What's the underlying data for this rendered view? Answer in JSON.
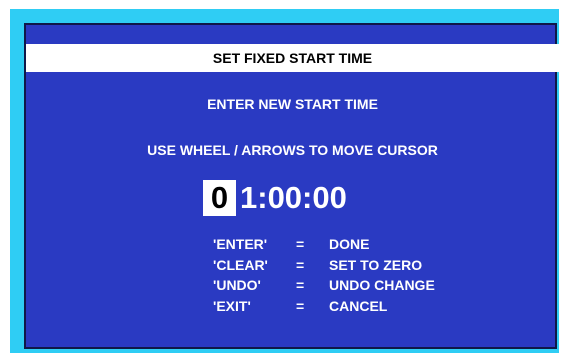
{
  "dialog": {
    "title": "SET FIXED START TIME",
    "instruction_1": "ENTER NEW START TIME",
    "instruction_2": "USE WHEEL / ARROWS TO MOVE CURSOR"
  },
  "time_entry": {
    "cursor_digit": "0",
    "remaining": "1:00:00"
  },
  "key_legend": [
    {
      "key": "'ENTER'",
      "eq": "=",
      "action": "DONE"
    },
    {
      "key": "'CLEAR'",
      "eq": "=",
      "action": "SET TO ZERO"
    },
    {
      "key": "'UNDO'",
      "eq": "=",
      "action": "UNDO CHANGE"
    },
    {
      "key": "'EXIT'",
      "eq": "=",
      "action": "CANCEL"
    }
  ],
  "colors": {
    "frame": "#2fcdf4",
    "screen": "#2a3ac2",
    "title_bar": "#ffffff",
    "text": "#ffffff"
  }
}
